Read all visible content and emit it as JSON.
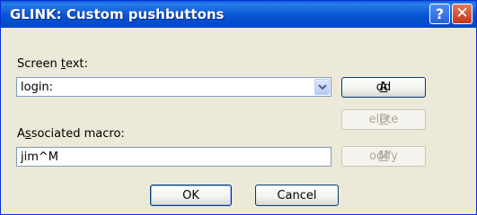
{
  "window": {
    "title": "GLINK: Custom pushbuttons",
    "help_glyph": "?",
    "close_glyph": "✕"
  },
  "screen_text": {
    "label_pre": "Screen ",
    "label_accel": "t",
    "label_post": "ext:",
    "value": "login:"
  },
  "macro": {
    "label_pre": "A",
    "label_accel": "s",
    "label_post": "sociated macro:",
    "value": "jim^M"
  },
  "buttons": {
    "add": {
      "accel": "A",
      "rest": "dd"
    },
    "delete": {
      "accel": "D",
      "rest": "elete"
    },
    "modify": {
      "accel": "M",
      "rest": "odify"
    },
    "ok": "OK",
    "cancel": "Cancel"
  }
}
